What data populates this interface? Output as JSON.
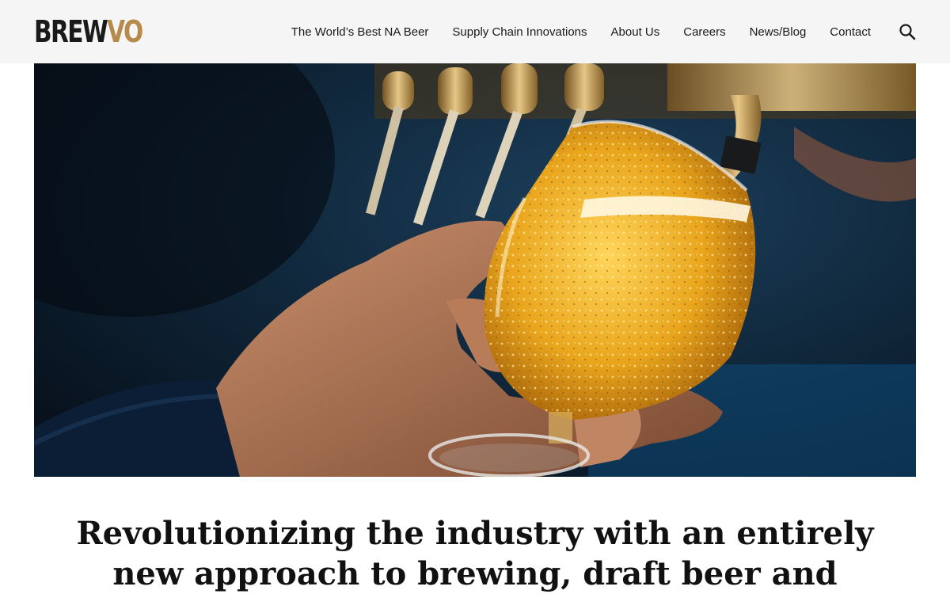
{
  "brand": {
    "logo_text_main": "BREW",
    "logo_text_accent": "VO",
    "accent_color": "#b58a4a",
    "logo_alt": "BREWVO logo"
  },
  "nav": {
    "items": [
      {
        "label": "The World’s Best NA Beer"
      },
      {
        "label": "Supply Chain Innovations"
      },
      {
        "label": "About Us"
      },
      {
        "label": "Careers"
      },
      {
        "label": "News/Blog"
      },
      {
        "label": "Contact"
      }
    ],
    "search_icon": "search-icon"
  },
  "hero": {
    "image_alt": "Hand holding a glass of beer being poured from a golden tap"
  },
  "headline": {
    "text": "Revolutionizing the industry with an entirely new approach to brewing, draft beer and"
  }
}
